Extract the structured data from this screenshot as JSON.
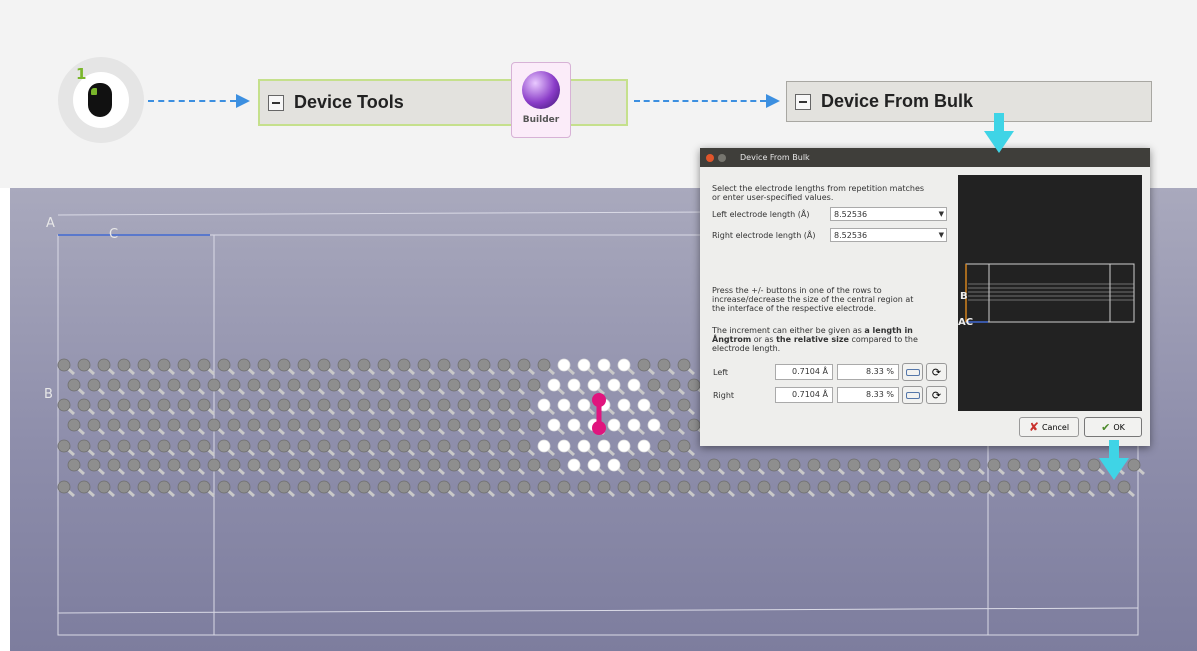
{
  "step": {
    "number": "1",
    "icon": "mouse-icon"
  },
  "nav": {
    "device_tools": "Device Tools",
    "builder": "Builder",
    "device_from_bulk": "Device From Bulk"
  },
  "viewport": {
    "label_a": "A",
    "label_c": "C",
    "label_b": "B"
  },
  "dialog": {
    "title": "Device From Bulk",
    "intro_line1": "Select the electrode lengths from repetition matches",
    "intro_line2": "or enter user-specified values.",
    "left_length_label": "Left electrode length (Å)",
    "left_length_value": "8.52536",
    "right_length_label": "Right electrode length (Å)",
    "right_length_value": "8.52536",
    "press_line1": "Press the +/- buttons in one of the rows to",
    "press_line2": "increase/decrease the size of the central region at",
    "press_line3": "the interface of the respective electrode.",
    "increment_line1_a": "The increment can either be given as ",
    "increment_line1_b": "a length in",
    "increment_line2_a": "Ångtrom",
    "increment_line2_b": " or as ",
    "increment_line2_c": "the relative size",
    "increment_line2_d": " compared to the",
    "increment_line3": "electrode length.",
    "left_label": "Left",
    "left_length": "0.7104 Å",
    "left_percent": "8.33 %",
    "right_label": "Right",
    "right_length": "0.7104 Å",
    "right_percent": "8.33 %",
    "cancel": "Cancel",
    "ok": "OK",
    "preview_label_b": "B",
    "preview_label_ac": "AC"
  },
  "colors": {
    "accent_arrow": "#3c8fe0",
    "cyan_pointer": "#3fd4e6",
    "step_green": "#7ab62b",
    "viewport_bg": "#9393ae",
    "dopant_atom": "#e0157e",
    "highlight_atom": "#ffffff",
    "carbon_atom": "#8e8e8e"
  }
}
